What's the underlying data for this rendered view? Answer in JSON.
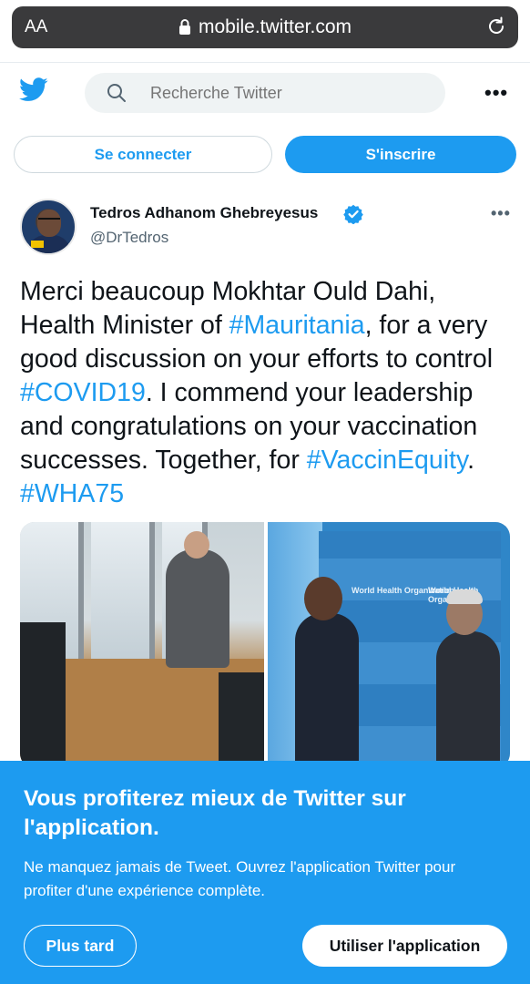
{
  "browser": {
    "text_size_label": "AA",
    "url": "mobile.twitter.com"
  },
  "header": {
    "search_placeholder": "Recherche Twitter"
  },
  "auth": {
    "login_label": "Se connecter",
    "signup_label": "S'inscrire"
  },
  "tweet": {
    "author_name": "Tedros Adhanom Ghebreyesus",
    "author_handle": "@DrTedros",
    "text_parts": [
      "Merci beaucoup Mokhtar Ould Dahi, Health Minister of ",
      "#Mauritania",
      ", for a very good discussion on your efforts to control ",
      "#COVID19",
      ". I commend your leadership and congratulations on your vaccination successes. Together, for ",
      "#VaccinEquity",
      ". ",
      "#WHA75"
    ]
  },
  "banner": {
    "title": "Vous profiterez mieux de Twitter sur l'application.",
    "description": "Ne manquez jamais de Tweet. Ouvrez l'application Twitter pour profiter d'une expérience complète.",
    "later_label": "Plus tard",
    "use_app_label": "Utiliser l'application"
  },
  "photo_right_label": "World Health Organization",
  "colors": {
    "accent": "#1d9bf0",
    "text": "#0f1419",
    "secondary": "#536471"
  },
  "icons": [
    "lock-icon",
    "reload-icon",
    "twitter-bird-icon",
    "search-icon",
    "more-icon",
    "verified-badge-icon",
    "tweet-more-icon"
  ]
}
